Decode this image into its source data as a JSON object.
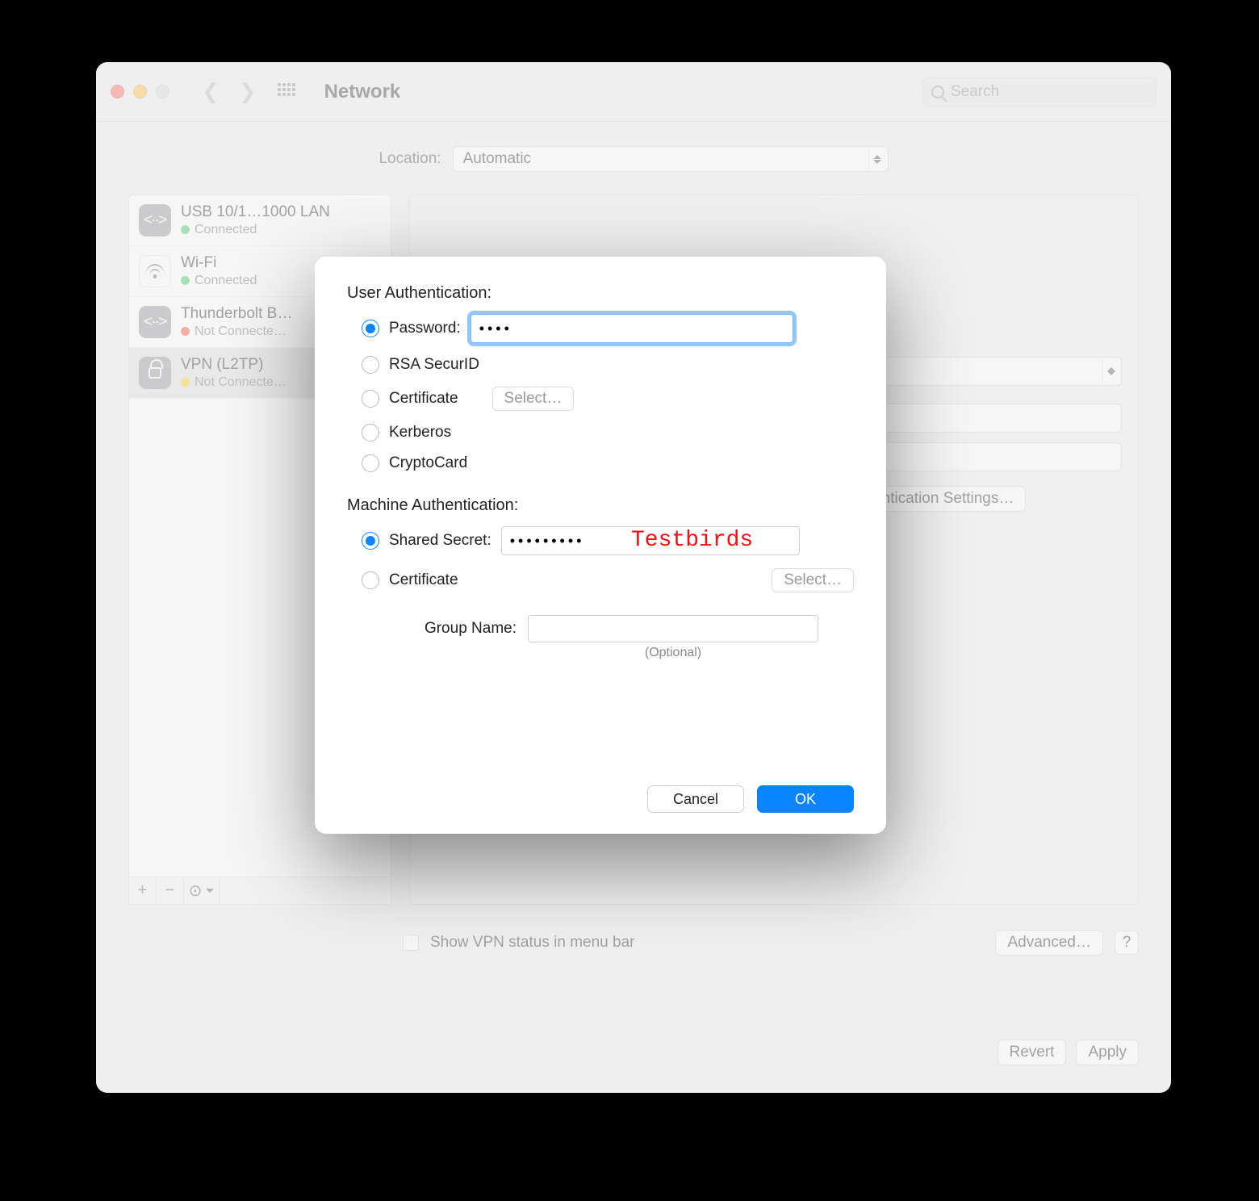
{
  "window": {
    "title": "Network",
    "search_placeholder": "Search"
  },
  "location": {
    "label": "Location:",
    "value": "Automatic"
  },
  "sidebar": {
    "items": [
      {
        "title": "USB 10/1…1000 LAN",
        "status": "Connected",
        "led": "green",
        "icon": "ethernet"
      },
      {
        "title": "Wi-Fi",
        "status": "Connected",
        "led": "green",
        "icon": "wifi"
      },
      {
        "title": "Thunderbolt B…",
        "status": "Not Connecte…",
        "led": "red",
        "icon": "ethernet"
      },
      {
        "title": "VPN (L2TP)",
        "status": "Not Connecte…",
        "led": "amber",
        "icon": "lock"
      }
    ]
  },
  "detail": {
    "show_vpn_status_label": "Show VPN status in menu bar",
    "advanced_label": "Advanced…",
    "help_label": "?",
    "revert_label": "Revert",
    "apply_label": "Apply",
    "auth_settings_label": "Authentication Settings…"
  },
  "dialog": {
    "user_auth_header": "User Authentication:",
    "options": {
      "password": "Password:",
      "rsa": "RSA SecurID",
      "certificate": "Certificate",
      "kerberos": "Kerberos",
      "cryptocard": "CryptoCard"
    },
    "password_value": "••••",
    "select_label": "Select…",
    "machine_auth_header": "Machine Authentication:",
    "shared_secret_label": "Shared Secret:",
    "shared_secret_value": "•••••••••",
    "shared_secret_annotation": "Testbirds",
    "machine_certificate_label": "Certificate",
    "group_name_label": "Group Name:",
    "group_name_value": "",
    "optional_hint": "(Optional)",
    "cancel": "Cancel",
    "ok": "OK"
  }
}
